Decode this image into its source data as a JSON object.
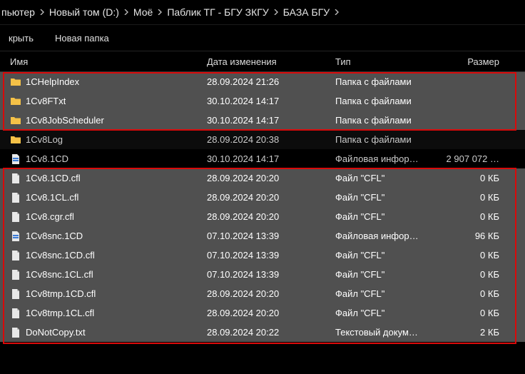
{
  "breadcrumb": [
    "пьютер",
    "Новый том (D:)",
    "Моё",
    "Паблик ТГ - БГУ ЗКГУ",
    "БАЗА БГУ"
  ],
  "toolbar": {
    "open_label": "крыть",
    "new_folder_label": "Новая папка"
  },
  "columns": {
    "name": "Имя",
    "date": "Дата изменения",
    "type": "Тип",
    "size": "Размер"
  },
  "rows": [
    {
      "icon": "folder",
      "name": "1CHelpIndex",
      "date": "28.09.2024 21:26",
      "type": "Папка с файлами",
      "size": "",
      "sel": true
    },
    {
      "icon": "folder",
      "name": "1Cv8FTxt",
      "date": "30.10.2024 14:17",
      "type": "Папка с файлами",
      "size": "",
      "sel": true
    },
    {
      "icon": "folder",
      "name": "1Cv8JobScheduler",
      "date": "30.10.2024 14:17",
      "type": "Папка с файлами",
      "size": "",
      "sel": true
    },
    {
      "icon": "folder",
      "name": "1Cv8Log",
      "date": "28.09.2024 20:38",
      "type": "Папка с файлами",
      "size": "",
      "sel": false
    },
    {
      "icon": "db",
      "name": "1Cv8.1CD",
      "date": "30.10.2024 14:17",
      "type": "Файловая инфор…",
      "size": "2 907 072 …",
      "sel": false
    },
    {
      "icon": "file",
      "name": "1Cv8.1CD.cfl",
      "date": "28.09.2024 20:20",
      "type": "Файл \"CFL\"",
      "size": "0 КБ",
      "sel": true
    },
    {
      "icon": "file",
      "name": "1Cv8.1CL.cfl",
      "date": "28.09.2024 20:20",
      "type": "Файл \"CFL\"",
      "size": "0 КБ",
      "sel": true
    },
    {
      "icon": "file",
      "name": "1Cv8.cgr.cfl",
      "date": "28.09.2024 20:20",
      "type": "Файл \"CFL\"",
      "size": "0 КБ",
      "sel": true
    },
    {
      "icon": "db",
      "name": "1Cv8snc.1CD",
      "date": "07.10.2024 13:39",
      "type": "Файловая инфор…",
      "size": "96 КБ",
      "sel": true
    },
    {
      "icon": "file",
      "name": "1Cv8snc.1CD.cfl",
      "date": "07.10.2024 13:39",
      "type": "Файл \"CFL\"",
      "size": "0 КБ",
      "sel": true
    },
    {
      "icon": "file",
      "name": "1Cv8snc.1CL.cfl",
      "date": "07.10.2024 13:39",
      "type": "Файл \"CFL\"",
      "size": "0 КБ",
      "sel": true
    },
    {
      "icon": "file",
      "name": "1Cv8tmp.1CD.cfl",
      "date": "28.09.2024 20:20",
      "type": "Файл \"CFL\"",
      "size": "0 КБ",
      "sel": true
    },
    {
      "icon": "file",
      "name": "1Cv8tmp.1CL.cfl",
      "date": "28.09.2024 20:20",
      "type": "Файл \"CFL\"",
      "size": "0 КБ",
      "sel": true
    },
    {
      "icon": "file",
      "name": "DoNotCopy.txt",
      "date": "28.09.2024 20:22",
      "type": "Текстовый докум…",
      "size": "2 КБ",
      "sel": true
    }
  ]
}
